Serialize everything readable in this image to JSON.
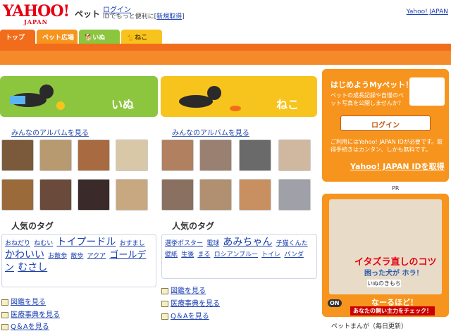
{
  "header": {
    "logo": "YAHOO!",
    "logo_sub": "JAPAN",
    "service": "ペット",
    "login": "ログイン",
    "sub_text": "IDでもっと便利に[",
    "signup": "新規取得",
    "sub_close": "]",
    "yahoo_japan": "Yahoo! JAPAN"
  },
  "tabs": [
    {
      "label": "トップ"
    },
    {
      "label": "ペット広場"
    },
    {
      "label": "いぬ"
    },
    {
      "label": "ねこ"
    }
  ],
  "inu": {
    "label": "いぬ",
    "album": "みんなのアルバムを見る",
    "tag_title": "人気のタグ",
    "tags": [
      {
        "t": "おねだり",
        "s": "t1"
      },
      {
        "t": "ねむい",
        "s": "t1"
      },
      {
        "t": "トイプードル",
        "s": "t3"
      },
      {
        "t": "おすまし",
        "s": "t1"
      },
      {
        "t": "かわいい",
        "s": "t3"
      },
      {
        "t": "お散歩",
        "s": "t1"
      },
      {
        "t": "散歩",
        "s": "t1"
      },
      {
        "t": "アクア",
        "s": "t1"
      },
      {
        "t": "ゴールデン",
        "s": "t2"
      },
      {
        "t": "むさし",
        "s": "t3"
      }
    ],
    "links": [
      "図鑑を見る",
      "医療事典を見る",
      "Q＆Aを見る"
    ]
  },
  "neko": {
    "label": "ねこ",
    "album": "みんなのアルバムを見る",
    "tag_title": "人気のタグ",
    "tags": [
      {
        "t": "選挙ポスター",
        "s": "t1"
      },
      {
        "t": "電球",
        "s": "t1"
      },
      {
        "t": "あみちゃん",
        "s": "t3"
      },
      {
        "t": "子猫くんた",
        "s": "t1"
      },
      {
        "t": "壁紙",
        "s": "t1"
      },
      {
        "t": "生後",
        "s": "t1"
      },
      {
        "t": "まる",
        "s": "t1"
      },
      {
        "t": "ロシアンブルー",
        "s": "t1"
      },
      {
        "t": "トイレ",
        "s": "t1"
      },
      {
        "t": "パンダ",
        "s": "t1"
      }
    ],
    "links": [
      "図鑑を見る",
      "医療事典を見る",
      "Q＆Aを見る"
    ]
  },
  "promo": {
    "title": "はじめようMyペット！",
    "desc": "ペットの成長記録や自慢のペット写真を公開しませんか？",
    "login_btn": "ログイン",
    "note": "ご利用にはYahoo! JAPAN IDが必要です。取得手続きはカンタン、しかも無料です。",
    "get_id": "Yahoo! JAPAN IDを取得",
    "pr": "PR"
  },
  "ad": {
    "headline": "イタズラ直しのコツ",
    "caption": "困った犬が ホラ！",
    "book": "いぬのきもち",
    "cta": "なーるほど！",
    "cta_sub": "あなたの飼い主力をチェック！",
    "on": "ON"
  },
  "manga": "ペットまんが（毎日更新）",
  "colors": {
    "orange": "#f7941d",
    "green": "#8cc63f",
    "yellow": "#f7c41d",
    "red": "#e60012"
  }
}
